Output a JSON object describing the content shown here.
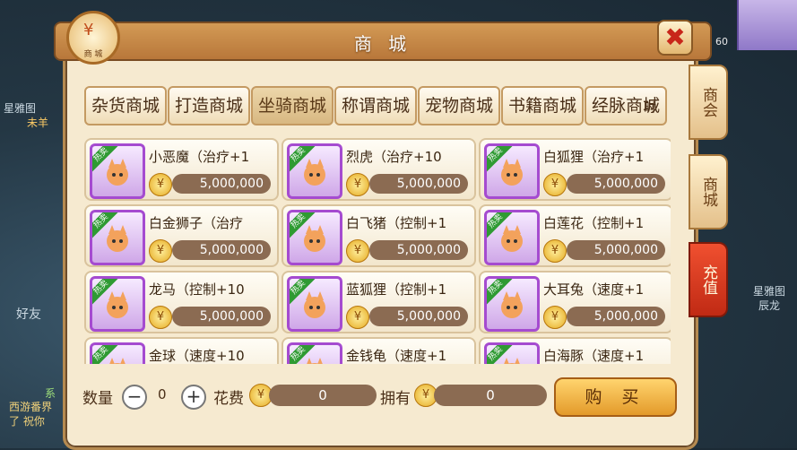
{
  "title": "商 城",
  "logo_label": "商  城",
  "close_label": "✖",
  "tabs": [
    {
      "label": "杂货商城",
      "active": false
    },
    {
      "label": "打造商城",
      "active": false
    },
    {
      "label": "坐骑商城",
      "active": true
    },
    {
      "label": "称谓商城",
      "active": false
    },
    {
      "label": "宠物商城",
      "active": false
    },
    {
      "label": "书籍商城",
      "active": false
    },
    {
      "label": "经脉商城",
      "active": false
    }
  ],
  "tab_overflow_suffix": "时",
  "items": [
    {
      "name": "小恶魔（治疗+1",
      "price": "5,000,000",
      "badge": "热卖"
    },
    {
      "name": "烈虎（治疗+10",
      "price": "5,000,000",
      "badge": "热卖"
    },
    {
      "name": "白狐狸（治疗+1",
      "price": "5,000,000",
      "badge": "热卖"
    },
    {
      "name": "白金狮子（治疗",
      "price": "5,000,000",
      "badge": "热卖"
    },
    {
      "name": "白飞猪（控制+1",
      "price": "5,000,000",
      "badge": "热卖"
    },
    {
      "name": "白莲花（控制+1",
      "price": "5,000,000",
      "badge": "热卖"
    },
    {
      "name": "龙马（控制+10",
      "price": "5,000,000",
      "badge": "热卖"
    },
    {
      "name": "蓝狐狸（控制+1",
      "price": "5,000,000",
      "badge": "热卖"
    },
    {
      "name": "大耳兔（速度+1",
      "price": "5,000,000",
      "badge": "热卖"
    },
    {
      "name": "金球（速度+10",
      "price": "",
      "badge": "热卖"
    },
    {
      "name": "金钱龟（速度+1",
      "price": "",
      "badge": "热卖"
    },
    {
      "name": "白海豚（速度+1",
      "price": "",
      "badge": "热卖"
    }
  ],
  "bottom": {
    "qty_label": "数量",
    "qty_value": "0",
    "minus": "−",
    "plus": "+",
    "cost_label": "花费",
    "cost_value": "0",
    "own_label": "拥有",
    "own_value": "0",
    "buy_label": "购 买"
  },
  "side_tabs": [
    {
      "label": "商会"
    },
    {
      "label": "商城"
    },
    {
      "label": "充值"
    }
  ],
  "hud": {
    "level": "60"
  },
  "background_text": {
    "left_top": "星雅图",
    "left_sub": "未羊",
    "left_mid": "好友",
    "left_bottom1": "系",
    "left_bottom2": "西游番界",
    "left_bottom3": "了 祝你",
    "right_mid": "星雅图",
    "right_mid2": "辰龙"
  },
  "colors": {
    "accent": "#b8773a",
    "panel": "#f6ead0",
    "hot_badge": "#2f9a33",
    "thumb_border": "#a54bd0",
    "recharge": "#d0341c"
  }
}
